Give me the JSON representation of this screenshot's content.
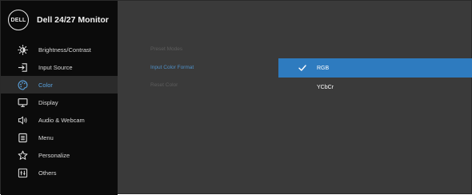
{
  "header": {
    "logo_text": "DELL",
    "title": "Dell 24/27 Monitor"
  },
  "menu": [
    {
      "label": "Brightness/Contrast",
      "icon": "brightness-icon"
    },
    {
      "label": "Input Source",
      "icon": "input-source-icon"
    },
    {
      "label": "Color",
      "icon": "color-palette-icon",
      "active": true
    },
    {
      "label": "Display",
      "icon": "display-icon"
    },
    {
      "label": "Audio & Webcam",
      "icon": "speaker-icon"
    },
    {
      "label": "Menu",
      "icon": "menu-icon"
    },
    {
      "label": "Personalize",
      "icon": "star-icon"
    },
    {
      "label": "Others",
      "icon": "others-icon"
    }
  ],
  "color_submenu": [
    {
      "label": "Preset Modes"
    },
    {
      "label": "Input Color Format",
      "active": true
    },
    {
      "label": "Reset Color"
    }
  ],
  "options": [
    {
      "label": "RGB",
      "selected": true
    },
    {
      "label": "YCbCr"
    }
  ],
  "colors": {
    "accent": "#2e7bbf",
    "active_text": "#5aa3df"
  }
}
